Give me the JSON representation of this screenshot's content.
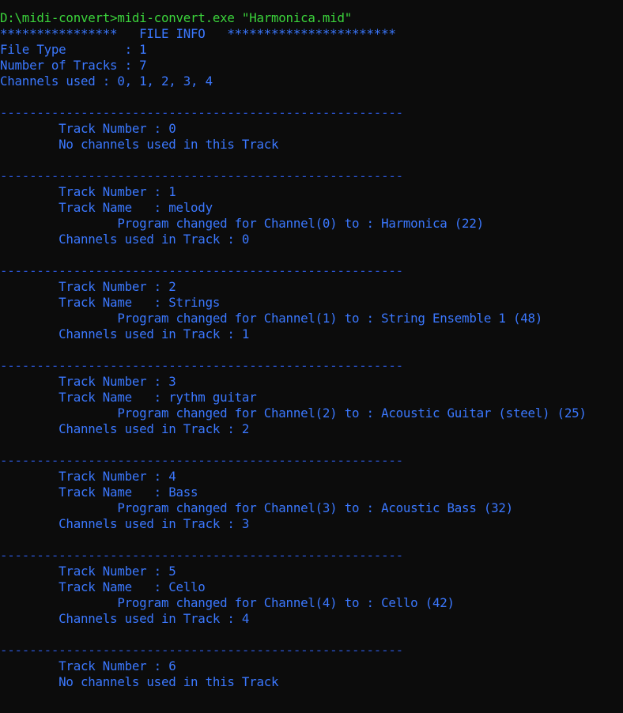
{
  "colors": {
    "background": "#0c0c0c",
    "command_text": "#3bd43b",
    "output_text": "#3b78ff",
    "separator": "#2b55d4"
  },
  "terminal": {
    "command": "D:\\midi-convert>midi-convert.exe \"Harmonica.mid\"",
    "header": "****************   FILE INFO   ***********************",
    "file_type": "File Type        : 1",
    "number_of_tracks": "Number of Tracks : 7",
    "channels_used": "Channels used : 0, 1, 2, 3, 4",
    "separator": "-------------------------------------------------------",
    "tracks": [
      {
        "number": "        Track Number : 0",
        "channels": "        No channels used in this Track"
      },
      {
        "number": "        Track Number : 1",
        "name": "        Track Name   : melody",
        "program": "                Program changed for Channel(0) to : Harmonica (22)",
        "channels": "        Channels used in Track : 0"
      },
      {
        "number": "        Track Number : 2",
        "name": "        Track Name   : Strings",
        "program": "                Program changed for Channel(1) to : String Ensemble 1 (48)",
        "channels": "        Channels used in Track : 1"
      },
      {
        "number": "        Track Number : 3",
        "name": "        Track Name   : rythm guitar",
        "program": "                Program changed for Channel(2) to : Acoustic Guitar (steel) (25)",
        "channels": "        Channels used in Track : 2"
      },
      {
        "number": "        Track Number : 4",
        "name": "        Track Name   : Bass",
        "program": "                Program changed for Channel(3) to : Acoustic Bass (32)",
        "channels": "        Channels used in Track : 3"
      },
      {
        "number": "        Track Number : 5",
        "name": "        Track Name   : Cello",
        "program": "                Program changed for Channel(4) to : Cello (42)",
        "channels": "        Channels used in Track : 4"
      },
      {
        "number": "        Track Number : 6",
        "channels": "        No channels used in this Track"
      }
    ]
  }
}
